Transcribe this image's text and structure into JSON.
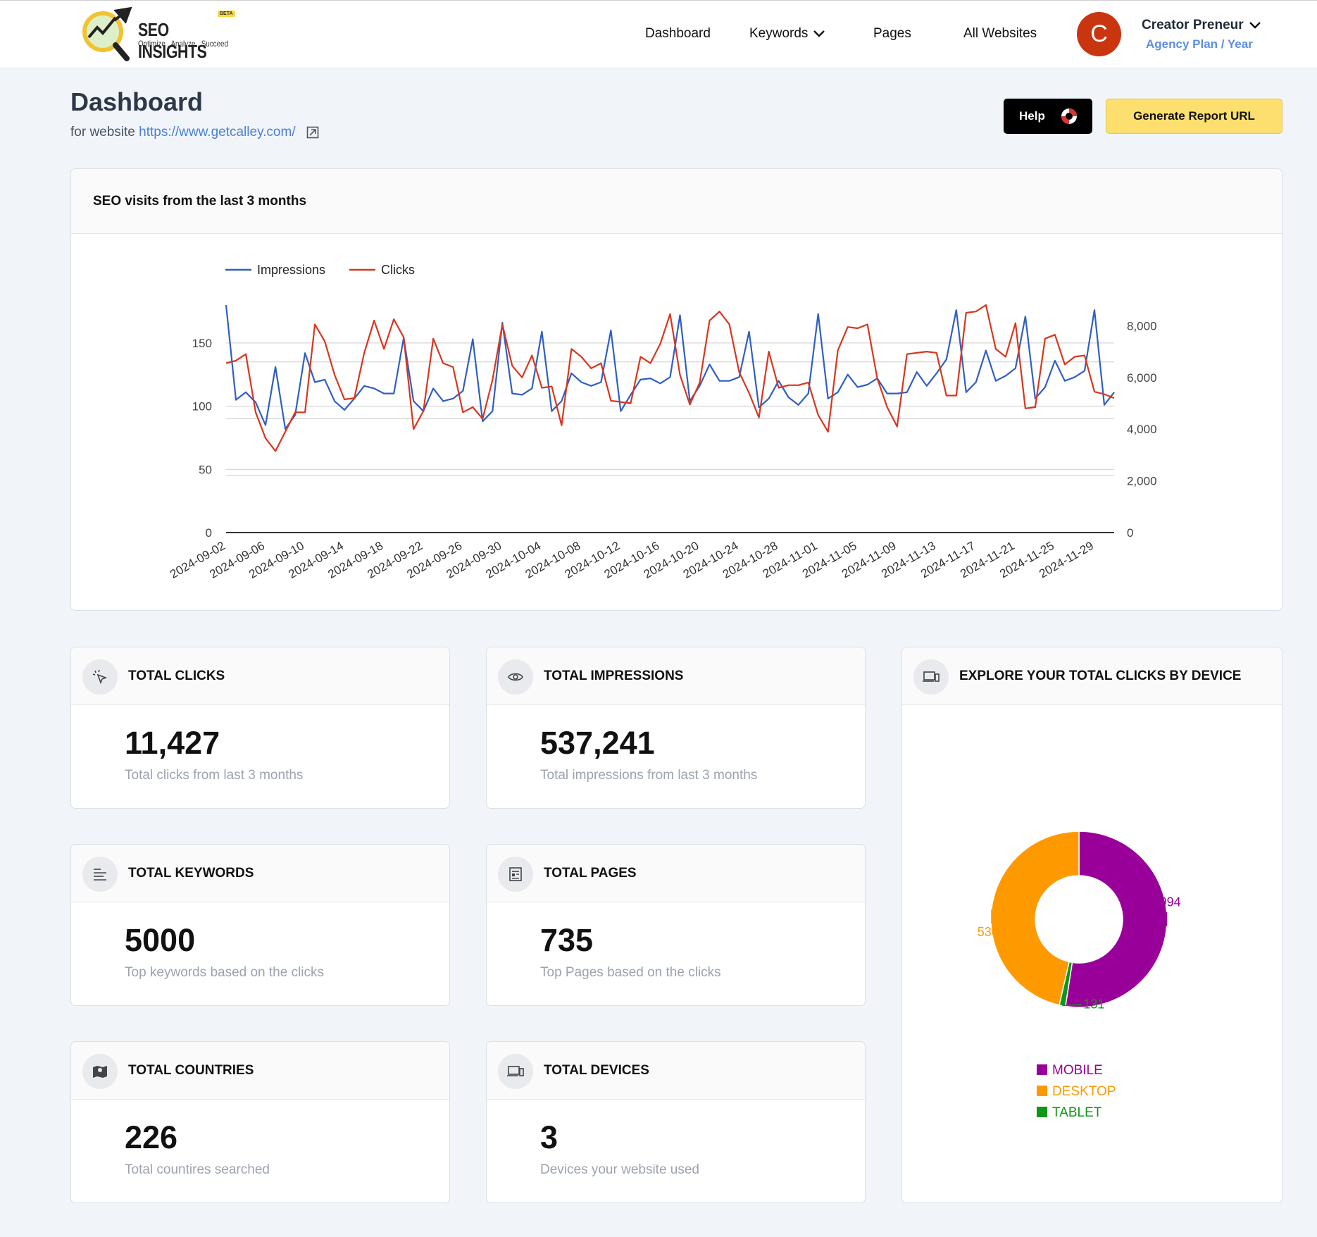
{
  "brand": {
    "title": "SEO INSIGHTS",
    "tagline": "Optimize . Analyze . Succeed",
    "badge": "BETA"
  },
  "nav": {
    "dashboard": "Dashboard",
    "keywords": "Keywords",
    "pages": "Pages",
    "all_websites": "All Websites"
  },
  "user": {
    "initial": "C",
    "name": "Creator Preneur",
    "plan": "Agency Plan / Year"
  },
  "header": {
    "title": "Dashboard",
    "subtitle_prefix": "for website",
    "website_url": "https://www.getcalley.com/",
    "help_label": "Help",
    "report_label": "Generate Report URL"
  },
  "visits_card": {
    "title": "SEO visits from the last 3 months"
  },
  "colors": {
    "impressions": "#2f5fc4",
    "clicks": "#d9361e",
    "mobile": "#990099",
    "desktop": "#ff9900",
    "tablet": "#109618"
  },
  "chart_data": {
    "type": "line",
    "title": "",
    "legend_position": "top-left",
    "grid": true,
    "x": [
      "2024-09-02",
      "2024-09-03",
      "2024-09-04",
      "2024-09-05",
      "2024-09-06",
      "2024-09-07",
      "2024-09-08",
      "2024-09-09",
      "2024-09-10",
      "2024-09-11",
      "2024-09-12",
      "2024-09-13",
      "2024-09-14",
      "2024-09-15",
      "2024-09-16",
      "2024-09-17",
      "2024-09-18",
      "2024-09-19",
      "2024-09-20",
      "2024-09-21",
      "2024-09-22",
      "2024-09-23",
      "2024-09-24",
      "2024-09-25",
      "2024-09-26",
      "2024-09-27",
      "2024-09-28",
      "2024-09-29",
      "2024-09-30",
      "2024-10-01",
      "2024-10-02",
      "2024-10-03",
      "2024-10-04",
      "2024-10-05",
      "2024-10-06",
      "2024-10-07",
      "2024-10-08",
      "2024-10-09",
      "2024-10-10",
      "2024-10-11",
      "2024-10-12",
      "2024-10-13",
      "2024-10-14",
      "2024-10-15",
      "2024-10-16",
      "2024-10-17",
      "2024-10-18",
      "2024-10-19",
      "2024-10-20",
      "2024-10-21",
      "2024-10-22",
      "2024-10-23",
      "2024-10-24",
      "2024-10-25",
      "2024-10-26",
      "2024-10-27",
      "2024-10-28",
      "2024-10-29",
      "2024-10-30",
      "2024-10-31",
      "2024-11-01",
      "2024-11-02",
      "2024-11-03",
      "2024-11-04",
      "2024-11-05",
      "2024-11-06",
      "2024-11-07",
      "2024-11-08",
      "2024-11-09",
      "2024-11-10",
      "2024-11-11",
      "2024-11-12",
      "2024-11-13",
      "2024-11-14",
      "2024-11-15",
      "2024-11-16",
      "2024-11-17",
      "2024-11-18",
      "2024-11-19",
      "2024-11-20",
      "2024-11-21",
      "2024-11-22",
      "2024-11-23",
      "2024-11-24",
      "2024-11-25",
      "2024-11-26",
      "2024-11-27",
      "2024-11-28",
      "2024-11-29",
      "2024-11-30",
      "2024-12-01"
    ],
    "x_tick_labels": [
      "2024-09-02",
      "2024-09-06",
      "2024-09-10",
      "2024-09-14",
      "2024-09-18",
      "2024-09-22",
      "2024-09-26",
      "2024-09-30",
      "2024-10-04",
      "2024-10-08",
      "2024-10-12",
      "2024-10-16",
      "2024-10-20",
      "2024-10-24",
      "2024-10-28",
      "2024-11-01",
      "2024-11-05",
      "2024-11-09",
      "2024-11-13",
      "2024-11-17",
      "2024-11-21",
      "2024-11-25",
      "2024-11-29"
    ],
    "y_left": {
      "min": 0,
      "max": 180,
      "ticks": [
        "0",
        "50",
        "100",
        "150"
      ]
    },
    "y_right": {
      "min": 0,
      "max": 8800,
      "ticks": [
        "0",
        "2,000",
        "4,000",
        "6,000",
        "8,000"
      ]
    },
    "series": [
      {
        "name": "Impressions",
        "axis": "left",
        "values": [
          180,
          105,
          111,
          103,
          85,
          131,
          82,
          93,
          142,
          119,
          121,
          104,
          97,
          106,
          116,
          114,
          110,
          110,
          154,
          104,
          96,
          114,
          104,
          106,
          112,
          153,
          88,
          96,
          166,
          110,
          109,
          114,
          159,
          96,
          104,
          126,
          119,
          116,
          119,
          160,
          96,
          109,
          121,
          122,
          118,
          123,
          172,
          104,
          116,
          133,
          120,
          120,
          123,
          159,
          99,
          106,
          120,
          107,
          101,
          110,
          173,
          106,
          111,
          125,
          115,
          117,
          122,
          110,
          110,
          111,
          127,
          116,
          126,
          137,
          176,
          111,
          119,
          144,
          120,
          124,
          130,
          171,
          106,
          115,
          136,
          120,
          123,
          128,
          176,
          101,
          111
        ]
      },
      {
        "name": "Clicks",
        "axis": "right",
        "values": [
          6550,
          6650,
          6900,
          4650,
          3650,
          3150,
          3900,
          4650,
          4650,
          8050,
          7400,
          6100,
          5150,
          5200,
          6950,
          8200,
          7100,
          8250,
          7550,
          4000,
          4700,
          7500,
          6550,
          6400,
          4650,
          4850,
          4400,
          5900,
          8050,
          6450,
          6000,
          6850,
          5600,
          5650,
          4150,
          7100,
          6800,
          6350,
          6550,
          5100,
          5050,
          5000,
          6800,
          6550,
          7300,
          8450,
          6100,
          4950,
          5800,
          8200,
          8550,
          8050,
          6200,
          5400,
          4450,
          7000,
          5600,
          5700,
          5700,
          5800,
          4550,
          3900,
          7050,
          7950,
          7900,
          8050,
          5950,
          4850,
          4100,
          6900,
          6950,
          7000,
          6950,
          5300,
          5300,
          8500,
          8550,
          8800,
          7100,
          6800,
          8100,
          4800,
          4850,
          7500,
          7650,
          6500,
          6800,
          6850,
          5450,
          5350,
          5200
        ]
      }
    ]
  },
  "stats": {
    "clicks": {
      "title": "TOTAL CLICKS",
      "value": "11,427",
      "desc": "Total clicks from last 3 months"
    },
    "impressions": {
      "title": "TOTAL IMPRESSIONS",
      "value": "537,241",
      "desc": "Total impressions from last 3 months"
    },
    "keywords": {
      "title": "TOTAL KEYWORDS",
      "value": "5000",
      "desc": "Top keywords based on the clicks"
    },
    "pages": {
      "title": "TOTAL PAGES",
      "value": "735",
      "desc": "Top Pages based on the clicks"
    },
    "countries": {
      "title": "TOTAL COUNTRIES",
      "value": "226",
      "desc": "Total countires searched"
    },
    "devices": {
      "title": "TOTAL DEVICES",
      "value": "3",
      "desc": "Devices your website used"
    }
  },
  "device_card": {
    "title": "EXPLORE YOUR TOTAL CLICKS BY DEVICE",
    "chart_data": {
      "type": "pie",
      "style": "donut",
      "legend_position": "bottom",
      "slices": [
        {
          "label": "MOBILE",
          "value": 5994,
          "value_label": "5994"
        },
        {
          "label": "TABLET",
          "value": 131,
          "value_label": "131"
        },
        {
          "label": "DESKTOP",
          "value": 5302,
          "value_label": "5302"
        }
      ],
      "legend": [
        "MOBILE",
        "DESKTOP",
        "TABLET"
      ]
    }
  }
}
